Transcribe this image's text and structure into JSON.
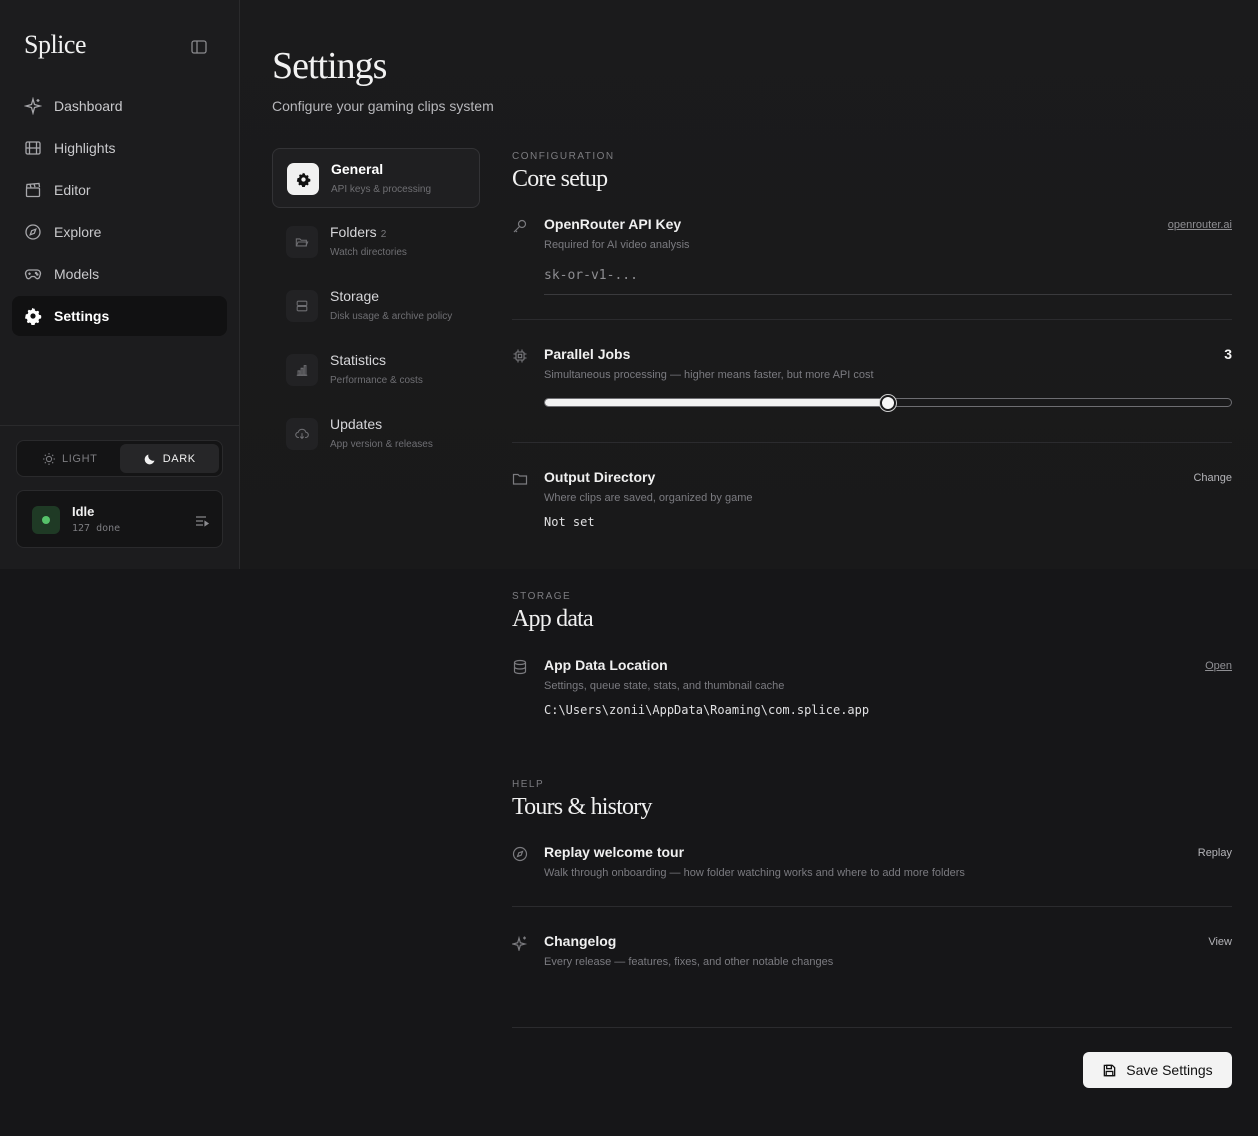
{
  "app": {
    "name": "Splice"
  },
  "sidebar": {
    "items": [
      {
        "label": "Dashboard",
        "icon": "sparkle-icon"
      },
      {
        "label": "Highlights",
        "icon": "film-icon"
      },
      {
        "label": "Editor",
        "icon": "clapperboard-icon"
      },
      {
        "label": "Explore",
        "icon": "compass-icon"
      },
      {
        "label": "Models",
        "icon": "gamepad-icon"
      },
      {
        "label": "Settings",
        "icon": "gear-icon",
        "active": true
      }
    ],
    "theme": {
      "light_label": "LIGHT",
      "dark_label": "DARK",
      "selected": "dark"
    },
    "status": {
      "title": "Idle",
      "count": "127",
      "count_suffix": "done",
      "color": "#56c26a"
    }
  },
  "page": {
    "title": "Settings",
    "subtitle": "Configure your gaming clips system"
  },
  "subnav": [
    {
      "title": "General",
      "desc": "API keys & processing",
      "active": true,
      "icon": "gear-icon"
    },
    {
      "title": "Folders",
      "count": "2",
      "desc": "Watch directories",
      "icon": "folder-open-icon"
    },
    {
      "title": "Storage",
      "desc": "Disk usage & archive policy",
      "icon": "database-icon"
    },
    {
      "title": "Statistics",
      "desc": "Performance & costs",
      "icon": "bar-chart-icon"
    },
    {
      "title": "Updates",
      "desc": "App version & releases",
      "icon": "cloud-download-icon"
    }
  ],
  "core": {
    "eyebrow": "CONFIGURATION",
    "title": "Core setup",
    "api_key": {
      "title": "OpenRouter API Key",
      "desc": "Required for AI video analysis",
      "link": "openrouter.ai",
      "placeholder": "sk-or-v1-..."
    },
    "parallel": {
      "title": "Parallel Jobs",
      "desc": "Simultaneous processing — higher means faster, but more API cost",
      "value": "3",
      "fraction": 0.5
    },
    "output": {
      "title": "Output Directory",
      "desc": "Where clips are saved, organized by game",
      "value": "Not set",
      "action": "Change"
    }
  },
  "storage": {
    "eyebrow": "STORAGE",
    "title": "App data",
    "location": {
      "title": "App Data Location",
      "desc": "Settings, queue state, stats, and thumbnail cache",
      "path": "C:\\Users\\zonii\\AppData\\Roaming\\com.splice.app",
      "action": "Open"
    }
  },
  "help": {
    "eyebrow": "HELP",
    "title": "Tours & history",
    "tour": {
      "title": "Replay welcome tour",
      "desc": "Walk through onboarding — how folder watching works and where to add more folders",
      "action": "Replay"
    },
    "changelog": {
      "title": "Changelog",
      "desc": "Every release — features, fixes, and other notable changes",
      "action": "View"
    }
  },
  "footer": {
    "save_label": "Save Settings"
  }
}
